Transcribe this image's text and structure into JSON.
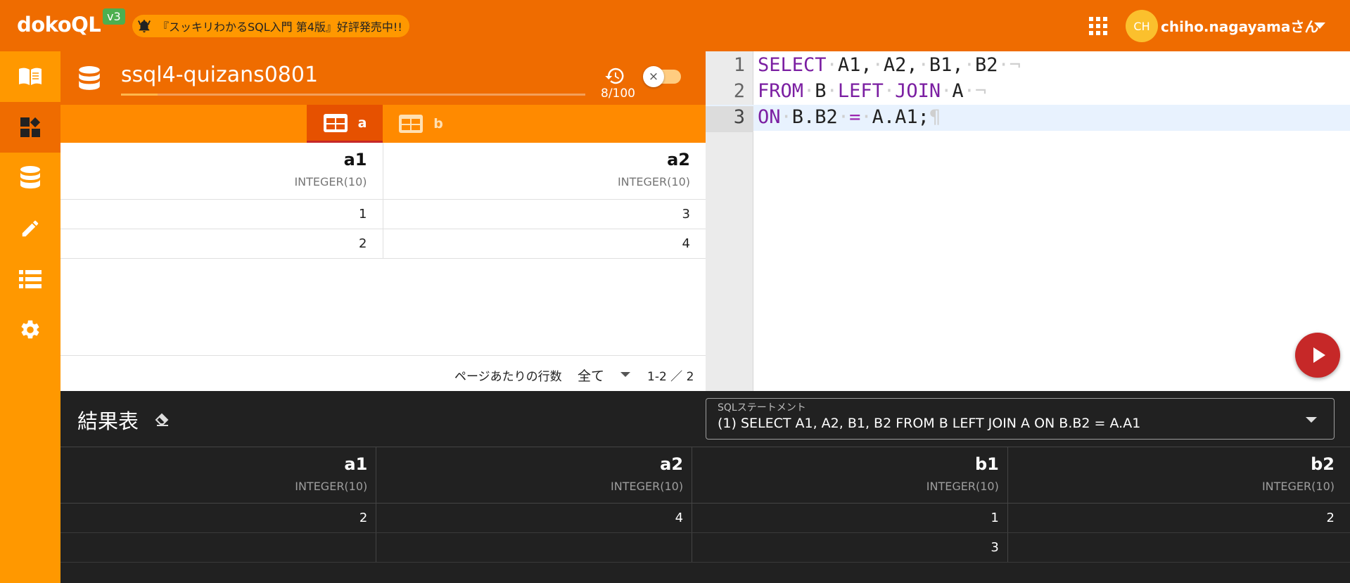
{
  "app": {
    "brand": "dokoQL",
    "version": "v3",
    "news": "『スッキリわかるSQL入門 第4版』好評発売中!!",
    "user_initials": "CH",
    "user_name": "chiho.nagayamaさん"
  },
  "colors": {
    "appbar": "#ef6c00",
    "rail": "#ff9800",
    "run_button": "#c62828",
    "keyword": "#7b1fa2"
  },
  "rail": {
    "items": [
      "book-icon",
      "dashboard-icon",
      "database-icon",
      "pencil-icon",
      "list-icon",
      "gear-icon"
    ],
    "active": "dashboard-icon"
  },
  "database": {
    "name": "ssql4-quizans0801",
    "history_count": "8/100",
    "toggle_close": "×",
    "tabs": [
      {
        "label": "a",
        "active": true
      },
      {
        "label": "b",
        "active": false
      }
    ],
    "table": {
      "columns": [
        {
          "name": "a1",
          "type": "INTEGER(10)"
        },
        {
          "name": "a2",
          "type": "INTEGER(10)"
        }
      ],
      "rows": [
        [
          "1",
          "3"
        ],
        [
          "2",
          "4"
        ]
      ]
    },
    "pager": {
      "rows_per_page_label": "ページあたりの行数",
      "rows_per_page_value": "全て",
      "range": "1-2 ／ 2"
    }
  },
  "editor": {
    "lines": [
      {
        "num": "1"
      },
      {
        "num": "2"
      },
      {
        "num": "3"
      }
    ],
    "current_line": 3
  },
  "results": {
    "title": "結果表",
    "statement_label": "SQLステートメント",
    "statement_value": "(1) SELECT A1, A2, B1, B2 FROM B LEFT JOIN A ON B.B2 = A.A1",
    "columns": [
      {
        "name": "a1",
        "type": "INTEGER(10)"
      },
      {
        "name": "a2",
        "type": "INTEGER(10)"
      },
      {
        "name": "b1",
        "type": "INTEGER(10)"
      },
      {
        "name": "b2",
        "type": "INTEGER(10)"
      }
    ],
    "rows": [
      [
        "2",
        "4",
        "1",
        "2"
      ],
      [
        "",
        "",
        "3",
        ""
      ]
    ]
  }
}
